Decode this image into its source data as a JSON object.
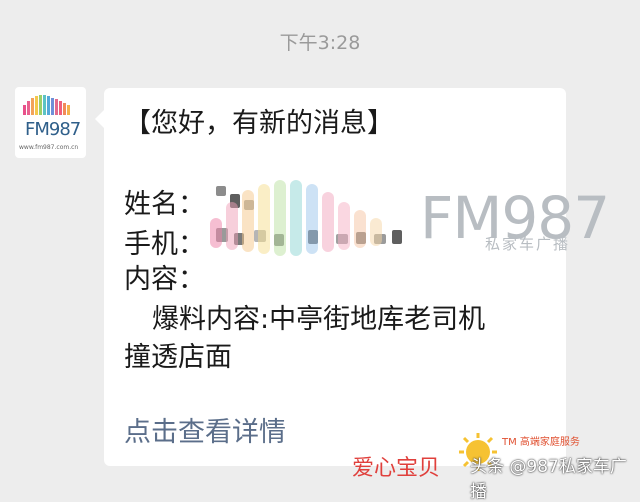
{
  "timestamp": "下午3:28",
  "avatar": {
    "brand": "FM987",
    "url": "www.fm987.com.cn"
  },
  "message": {
    "header": "【您好，有新的消息】",
    "name_label": "姓名：",
    "phone_label": "手机：",
    "content_label": "内容：",
    "content_line1": "爆料内容:中亭街地库老司机",
    "content_line2": "撞透店面",
    "detail_link": "点击查看详情"
  },
  "watermark": {
    "brand": "FM987",
    "sub": "私家车广播"
  },
  "footer_watermark": {
    "tm": "TM 高端家庭服务",
    "love": "爱心宝贝",
    "handle": "头条 @987私家车广播"
  },
  "colors": {
    "background": "#ededed",
    "bubble": "#ffffff",
    "link": "#5b6e8a",
    "text": "#1a1a1a"
  }
}
